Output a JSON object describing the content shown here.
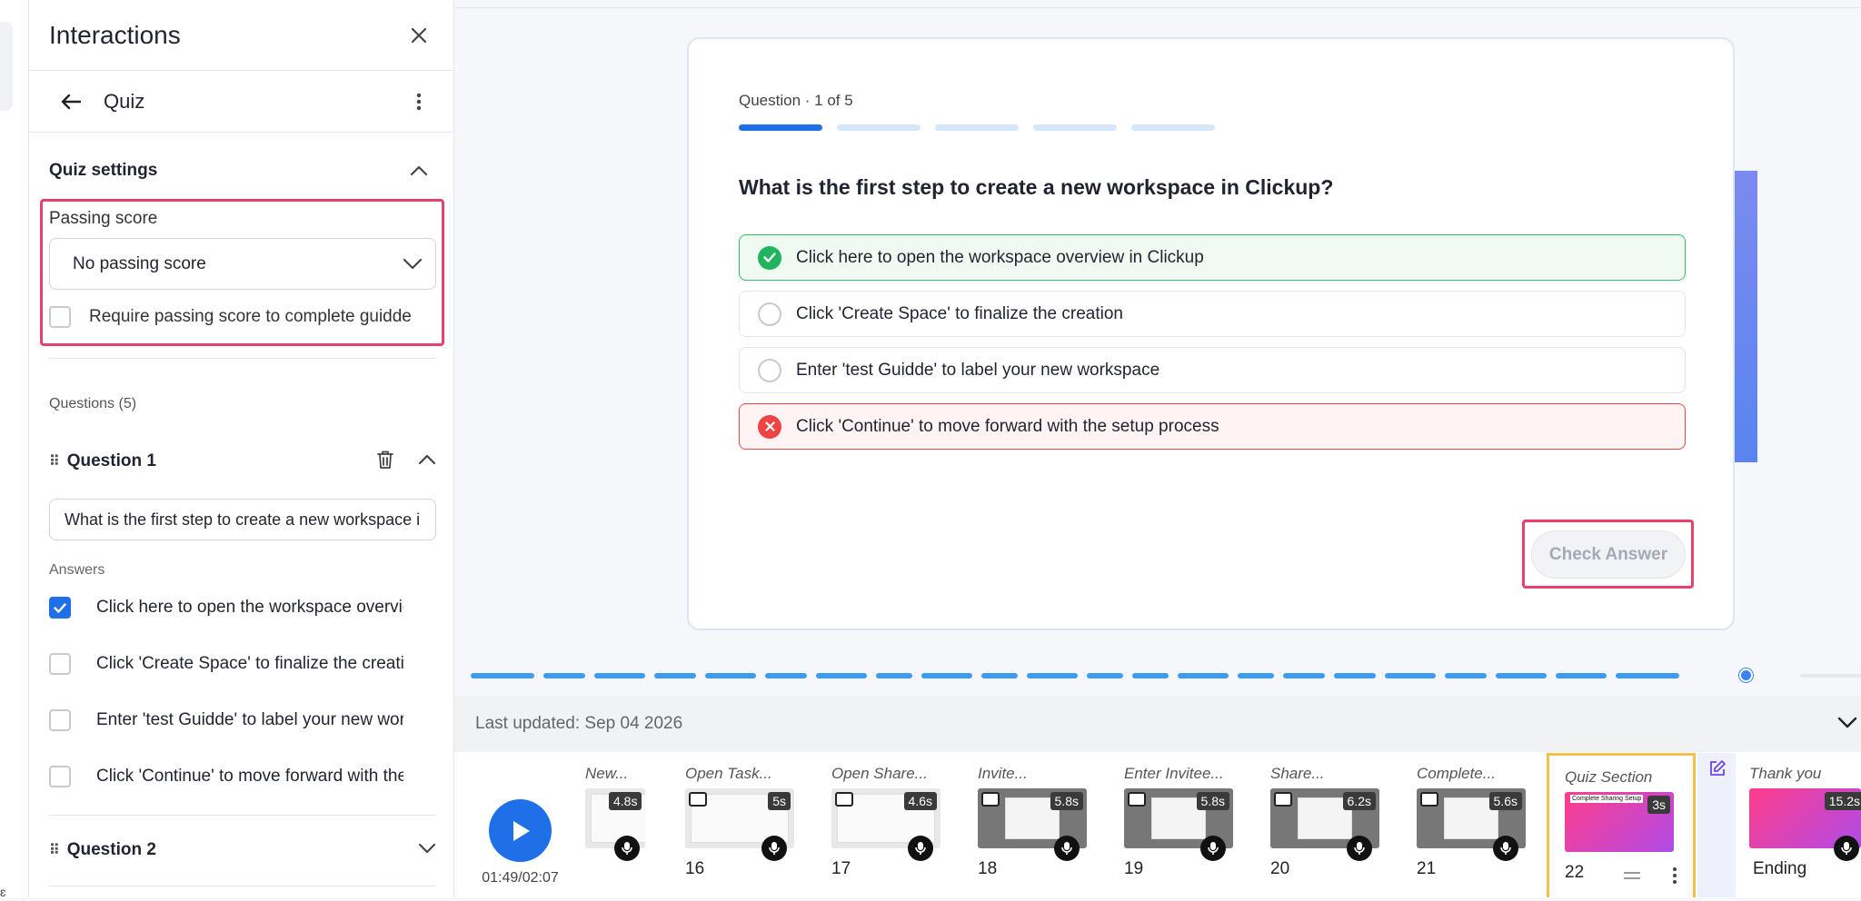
{
  "panel": {
    "title": "Interactions",
    "subtitle": "Quiz",
    "settings_title": "Quiz settings",
    "passing_label": "Passing score",
    "passing_value": "No passing score",
    "require_label": "Require passing score to complete guidde",
    "questions_title": "Questions (5)",
    "q1_title": "Question 1",
    "q1_text": "What is the first step to create a new workspace in Clickup?",
    "answers_label": "Answers",
    "answers": [
      {
        "label": "Click here to open the workspace overview in Clickup",
        "checked": true
      },
      {
        "label": "Click 'Create Space' to finalize the creation",
        "checked": false
      },
      {
        "label": "Enter 'test Guidde' to label your new workspace",
        "checked": false
      },
      {
        "label": "Click 'Continue' to move forward with the setup process",
        "checked": false
      }
    ],
    "q2_title": "Question 2"
  },
  "quiz": {
    "counter": "Question · 1 of 5",
    "progress": {
      "current": 1,
      "total": 5
    },
    "question": "What is the first step to create a new workspace in Clickup?",
    "options": [
      {
        "label": "Click here to open the workspace overview in Clickup",
        "state": "correct"
      },
      {
        "label": "Click 'Create Space' to finalize the creation",
        "state": "none"
      },
      {
        "label": "Enter 'test Guidde' to label your new workspace",
        "state": "none"
      },
      {
        "label": "Click 'Continue' to move forward with the setup process",
        "state": "wrong"
      }
    ],
    "check_label": "Check Answer"
  },
  "timeline": {
    "progress_fraction": 0.95,
    "last_updated": "Last updated: Sep 04 2026",
    "time": "01:49/02:07",
    "scenes": [
      {
        "title": "New...",
        "duration": "4.8s",
        "number": ""
      },
      {
        "title": "Open Task...",
        "duration": "5s",
        "number": "16"
      },
      {
        "title": "Open Share...",
        "duration": "4.6s",
        "number": "17"
      },
      {
        "title": "Invite...",
        "duration": "5.8s",
        "number": "18"
      },
      {
        "title": "Enter Invitee...",
        "duration": "5.8s",
        "number": "19"
      },
      {
        "title": "Share...",
        "duration": "6.2s",
        "number": "20"
      },
      {
        "title": "Complete...",
        "duration": "5.6s",
        "number": "21"
      }
    ],
    "quiz_scene": {
      "title": "Quiz Section",
      "duration": "3s",
      "number": "22",
      "thumb_text": "Complete Sharing Setup"
    },
    "end_scene": {
      "title": "Thank you",
      "duration": "15.2s",
      "label": "Ending"
    }
  },
  "colors": {
    "accent": "#1e6fe8",
    "highlight": "#e9416b",
    "correct": "#34c06a",
    "wrong": "#ef4444"
  }
}
